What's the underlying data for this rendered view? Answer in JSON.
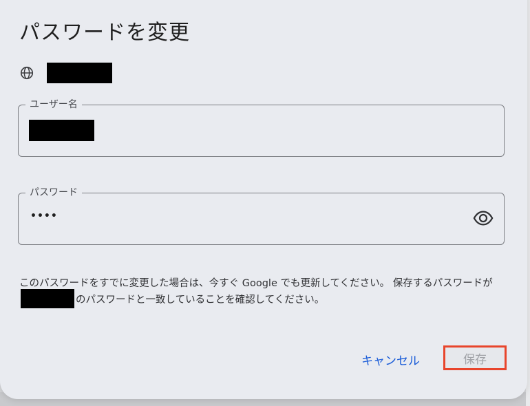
{
  "dialog": {
    "title": "パスワードを変更",
    "username_label": "ユーザー名",
    "password_label": "パスワード",
    "password_value": "••••",
    "note_part1": "このパスワードをすでに変更した場合は、今すぐ Google でも更新してください。 保存するパスワードが",
    "note_part2": "のパスワードと一致していることを確認してください。",
    "cancel_label": "キャンセル",
    "save_label": "保存"
  },
  "icons": {
    "site": "globe-icon",
    "toggle_visibility": "eye-icon"
  },
  "colors": {
    "accent": "#1a5cd8",
    "highlight_border": "#e8452c",
    "dialog_bg": "#e9ebf0"
  }
}
